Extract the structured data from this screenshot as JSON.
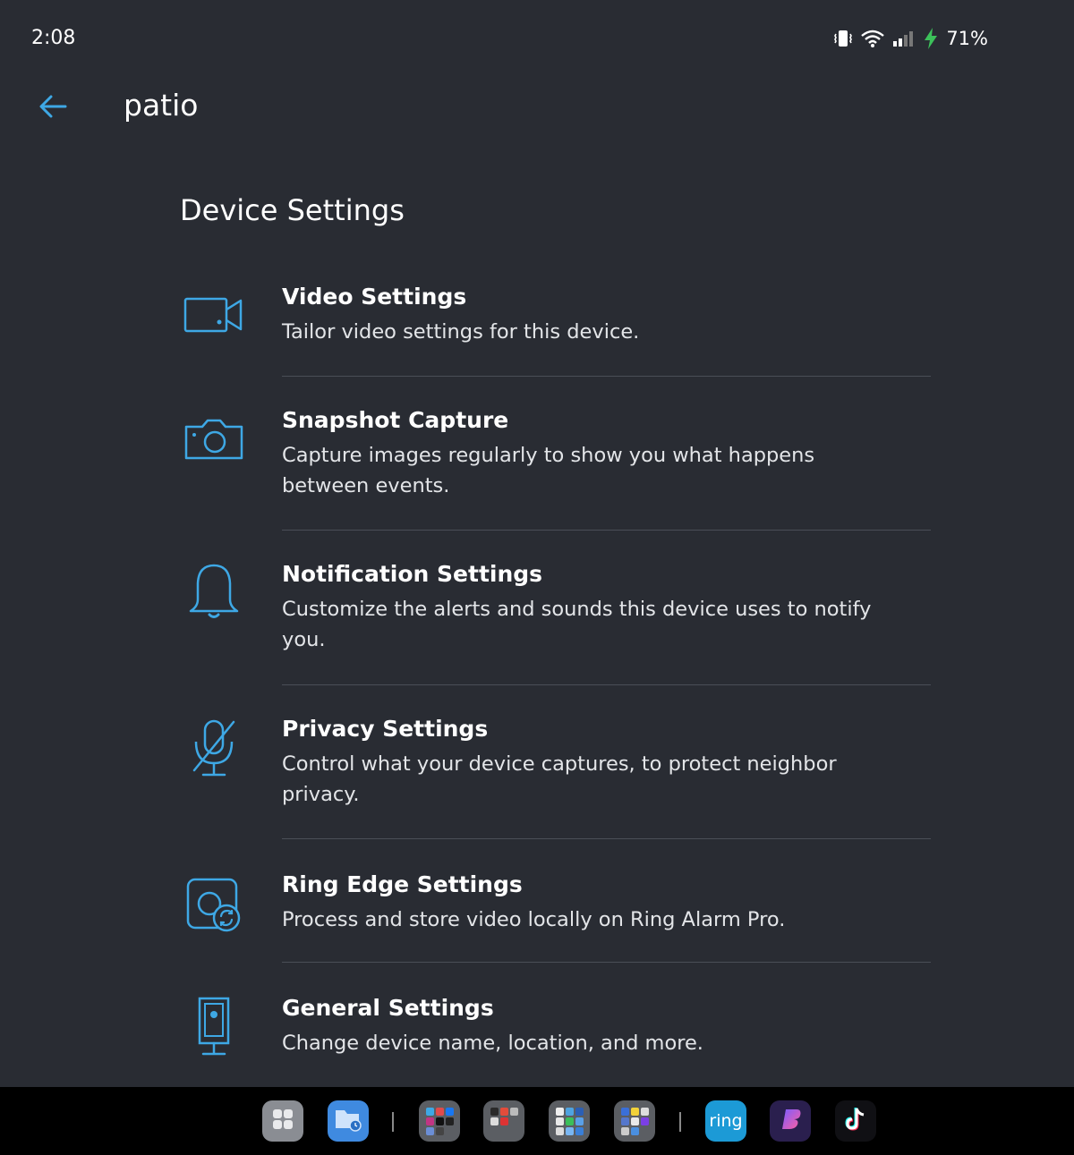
{
  "status_bar": {
    "time": "2:08",
    "battery": "71%",
    "icons": [
      "vibrate-icon",
      "wifi-icon",
      "signal-icon",
      "charging-icon"
    ]
  },
  "app_bar": {
    "title": "patio",
    "back_icon": "arrow-left-icon"
  },
  "section": {
    "title": "Device Settings"
  },
  "settings": [
    {
      "icon": "video-camera-icon",
      "title": "Video Settings",
      "description": "Tailor video settings for this device."
    },
    {
      "icon": "camera-icon",
      "title": "Snapshot Capture",
      "description": "Capture images regularly to show you what happens between events."
    },
    {
      "icon": "bell-icon",
      "title": "Notification Settings",
      "description": "Customize the alerts and sounds this device uses to notify you."
    },
    {
      "icon": "mic-off-icon",
      "title": "Privacy Settings",
      "description": "Control what your device captures, to protect neighbor privacy."
    },
    {
      "icon": "ring-edge-icon",
      "title": "Ring Edge Settings",
      "description": "Process and store video locally on Ring Alarm Pro."
    },
    {
      "icon": "camera-device-icon",
      "title": "General Settings",
      "description": "Change device name, location, and more."
    }
  ],
  "dock": {
    "ring_label": "ring"
  },
  "colors": {
    "background": "#292c33",
    "accent": "#3ea8e5",
    "divider": "#4a4e57",
    "charging": "#3cc15a"
  }
}
